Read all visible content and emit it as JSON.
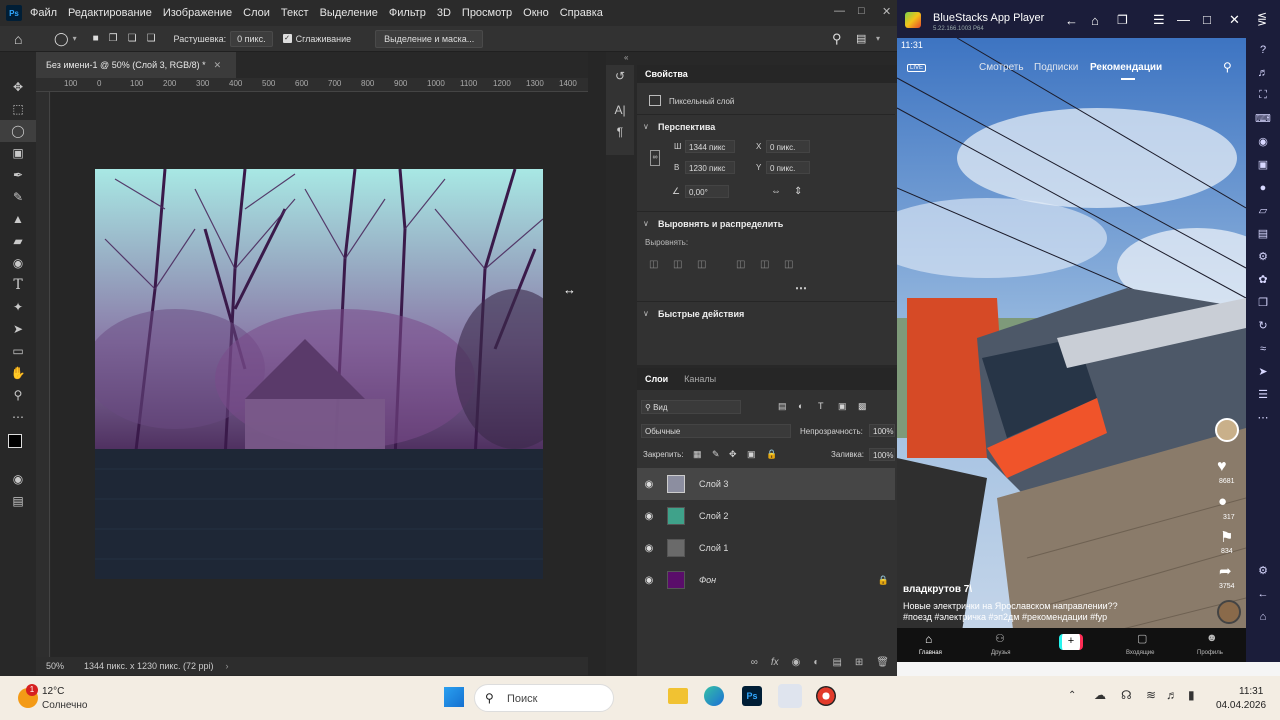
{
  "ps": {
    "logo": "Ps",
    "menu": [
      "Файл",
      "Редактирование",
      "Изображение",
      "Слои",
      "Текст",
      "Выделение",
      "Фильтр",
      "3D",
      "Просмотр",
      "Окно",
      "Справка"
    ],
    "options": {
      "feather_label": "Растушевка:",
      "feather_value": "0 пикс.",
      "antialias_label": "Сглаживание",
      "select_mask_button": "Выделение и маска..."
    },
    "doc_tab": "Без имени-1 @ 50% (Слой 3, RGB/8) *",
    "ruler_ticks": [
      "100",
      "0",
      "100",
      "200",
      "300",
      "400",
      "500",
      "600",
      "700",
      "800",
      "900",
      "1000",
      "1100",
      "1200",
      "1300",
      "1400"
    ],
    "status": {
      "zoom": "50%",
      "doc_info": "1344 пикс. x 1230 пикс. (72 ppi)"
    },
    "properties": {
      "tab": "Свойства",
      "layer_type": "Пиксельный слой",
      "section_transform": "Перспектива",
      "w_label": "Ш",
      "w_value": "1344 пикс",
      "h_label": "В",
      "h_value": "1230 пикс",
      "x_label": "X",
      "x_value": "0 пикс.",
      "y_label": "Y",
      "y_value": "0 пикс.",
      "angle_value": "0,00°",
      "section_align": "Выровнять и распределить",
      "align_label": "Выровнять:",
      "section_quick": "Быстрые действия"
    },
    "layers_panel": {
      "tabs": [
        "Слои",
        "Каналы"
      ],
      "filter_label": "Вид",
      "blend_mode": "Обычные",
      "opacity_label": "Непрозрачность:",
      "opacity_value": "100%",
      "lock_label": "Закрепить:",
      "fill_label": "Заливка:",
      "fill_value": "100%",
      "layers": [
        {
          "name": "Слой 3",
          "selected": true,
          "thumb_color": "#8c8ea0"
        },
        {
          "name": "Слой 2",
          "selected": false,
          "thumb_color": "#3fa28a"
        },
        {
          "name": "Слой 1",
          "selected": false,
          "thumb_color": "#6a6a6a"
        },
        {
          "name": "Фон",
          "selected": false,
          "thumb_color": "#5a0d6a",
          "locked": true
        }
      ]
    }
  },
  "bluestacks": {
    "title": "BlueStacks App Player",
    "version": "5.22.166.1003  P64",
    "time": "11:31",
    "live_label": "LIVE",
    "tabs": [
      "Смотреть",
      "Подписки",
      "Рекомендации"
    ],
    "author": "владкрутов 7\\",
    "caption_line1": "Новые электрички на Ярославском направлении??",
    "caption_line2": "#поезд #электричка #эп2дм #рекомендации #fyp",
    "likes": "8681",
    "comments": "317",
    "saves": "834",
    "shares": "3754",
    "bottom_nav": [
      "Главная",
      "Друзья",
      "Входящие",
      "Профиль"
    ]
  },
  "taskbar": {
    "weather_temp": "12°C",
    "weather_text": "Солнечно",
    "search_placeholder": "Поиск",
    "clock_time": "11:31",
    "clock_date": "04.04.2026"
  }
}
